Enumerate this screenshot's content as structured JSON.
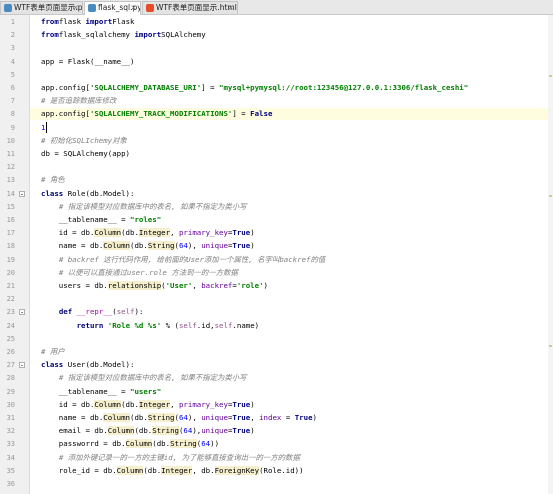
{
  "tabs": [
    {
      "label": "WTF表单页面显示.py",
      "icon": "python-file-icon",
      "color": "#4b8bbe",
      "active": false
    },
    {
      "label": "flask_sql.py",
      "icon": "python-file-icon",
      "color": "#4b8bbe",
      "active": true
    },
    {
      "label": "WTF表单页面显示.html",
      "icon": "html-file-icon",
      "color": "#e44d26",
      "active": false
    }
  ],
  "close_glyph": "×",
  "lines": [
    {
      "n": "1",
      "segs": [
        [
          "kw",
          "from"
        ],
        [
          "",
          "flask "
        ],
        [
          "kw",
          "import"
        ],
        [
          "",
          "Flask"
        ]
      ]
    },
    {
      "n": "2",
      "segs": [
        [
          "kw",
          "from"
        ],
        [
          "",
          "flask_sqlalchemy "
        ],
        [
          "kw",
          "import"
        ],
        [
          "",
          "SQLAlchemy"
        ]
      ]
    },
    {
      "n": "3",
      "segs": []
    },
    {
      "n": "4",
      "segs": [
        [
          "",
          "app = Flask(__name__)"
        ]
      ]
    },
    {
      "n": "5",
      "segs": []
    },
    {
      "n": "6",
      "segs": [
        [
          "",
          "app.config["
        ],
        [
          "str",
          "'SQLALCHEMY_DATABASE_URI'"
        ],
        [
          "",
          "] = "
        ],
        [
          "str",
          "\"mysql+pymysql://root:123456@127.0.0.1:3306/flask_ceshi\""
        ]
      ]
    },
    {
      "n": "7",
      "segs": [
        [
          "cm",
          "# 是否追踪数据库修改"
        ]
      ]
    },
    {
      "n": "8",
      "segs": [
        [
          "",
          "app.config["
        ],
        [
          "str",
          "'SQLALCHEMY_TRACK_MODIFICATIONS'"
        ],
        [
          "",
          "] = "
        ],
        [
          "kw",
          "False"
        ]
      ],
      "current": true
    },
    {
      "n": "9",
      "segs": [
        [
          "num",
          "1"
        ]
      ]
    },
    {
      "n": "10",
      "segs": [
        [
          "cm",
          "# 初始化SQLIchemy对象"
        ]
      ]
    },
    {
      "n": "11",
      "segs": [
        [
          "",
          "db = SQLAlchemy(app)"
        ]
      ]
    },
    {
      "n": "12",
      "segs": []
    },
    {
      "n": "13",
      "segs": [
        [
          "cm",
          "# 角色"
        ]
      ]
    },
    {
      "n": "14",
      "segs": [
        [
          "kw",
          "class "
        ],
        [
          "",
          "Role(db.Model):"
        ]
      ],
      "fold": true
    },
    {
      "n": "15",
      "segs": [
        [
          "",
          "    "
        ],
        [
          "cm",
          "# 指定该模型对应数据库中的表名, 如果不指定为类小写"
        ]
      ]
    },
    {
      "n": "16",
      "segs": [
        [
          "",
          "    __tablename__ = "
        ],
        [
          "str",
          "\"roles\""
        ]
      ]
    },
    {
      "n": "17",
      "segs": [
        [
          "",
          "    id = db."
        ],
        [
          "u",
          "Column"
        ],
        [
          "",
          "(db."
        ],
        [
          "u",
          "Integer"
        ],
        [
          "",
          ", "
        ],
        [
          "arg",
          "primary_key"
        ],
        [
          "",
          "="
        ],
        [
          "kw",
          "True"
        ],
        [
          "",
          ")"
        ]
      ]
    },
    {
      "n": "18",
      "segs": [
        [
          "",
          "    name = db."
        ],
        [
          "u",
          "Column"
        ],
        [
          "",
          "(db."
        ],
        [
          "u",
          "String"
        ],
        [
          "",
          "("
        ],
        [
          "num",
          "64"
        ],
        [
          "",
          "), "
        ],
        [
          "arg",
          "unique"
        ],
        [
          "",
          "="
        ],
        [
          "kw",
          "True"
        ],
        [
          "",
          ")"
        ]
      ]
    },
    {
      "n": "19",
      "segs": [
        [
          "",
          "    "
        ],
        [
          "cm",
          "# backref 这行代码作用, 给前面的User添加一个属性, 名字叫backref的值"
        ]
      ]
    },
    {
      "n": "20",
      "segs": [
        [
          "",
          "    "
        ],
        [
          "cm",
          "# 以便可以直接通过user.role 方法到一的一方数据"
        ]
      ]
    },
    {
      "n": "21",
      "segs": [
        [
          "",
          "    users = db."
        ],
        [
          "u",
          "relationship"
        ],
        [
          "",
          "("
        ],
        [
          "str",
          "'User'"
        ],
        [
          "",
          ", "
        ],
        [
          "arg",
          "backref"
        ],
        [
          "",
          "="
        ],
        [
          "str",
          "'role'"
        ],
        [
          "",
          ")"
        ]
      ]
    },
    {
      "n": "22",
      "segs": []
    },
    {
      "n": "23",
      "segs": [
        [
          "",
          "    "
        ],
        [
          "kw",
          "def "
        ],
        [
          "fn",
          "__repr__"
        ],
        [
          "",
          "("
        ],
        [
          "self",
          "self"
        ],
        [
          "",
          "):"
        ]
      ],
      "fold": true
    },
    {
      "n": "24",
      "segs": [
        [
          "",
          "        "
        ],
        [
          "kw",
          "return "
        ],
        [
          "str",
          "'Role %d %s'"
        ],
        [
          "",
          " % ("
        ],
        [
          "self",
          "self"
        ],
        [
          "",
          ".id,"
        ],
        [
          "self",
          "self"
        ],
        [
          "",
          ".name)"
        ]
      ]
    },
    {
      "n": "25",
      "segs": []
    },
    {
      "n": "26",
      "segs": [
        [
          "cm",
          "# 用户"
        ]
      ]
    },
    {
      "n": "27",
      "segs": [
        [
          "kw",
          "class "
        ],
        [
          "",
          "User(db.Model):"
        ]
      ],
      "fold": true
    },
    {
      "n": "28",
      "segs": [
        [
          "",
          "    "
        ],
        [
          "cm",
          "# 指定该模型对应数据库中的表名, 如果不指定为类小写"
        ]
      ]
    },
    {
      "n": "29",
      "segs": [
        [
          "",
          "    __tablename__ = "
        ],
        [
          "str",
          "\"users\""
        ]
      ]
    },
    {
      "n": "30",
      "segs": [
        [
          "",
          "    id = db."
        ],
        [
          "u",
          "Column"
        ],
        [
          "",
          "(db."
        ],
        [
          "u",
          "Integer"
        ],
        [
          "",
          ", "
        ],
        [
          "arg",
          "primary_key"
        ],
        [
          "",
          "="
        ],
        [
          "kw",
          "True"
        ],
        [
          "",
          ")"
        ]
      ]
    },
    {
      "n": "31",
      "segs": [
        [
          "",
          "    name = db."
        ],
        [
          "u",
          "Column"
        ],
        [
          "",
          "(db."
        ],
        [
          "u",
          "String"
        ],
        [
          "",
          "("
        ],
        [
          "num",
          "64"
        ],
        [
          "",
          "), "
        ],
        [
          "arg",
          "unique"
        ],
        [
          "",
          "="
        ],
        [
          "kw",
          "True"
        ],
        [
          "",
          ", "
        ],
        [
          "arg",
          "index"
        ],
        [
          "",
          " = "
        ],
        [
          "kw",
          "True"
        ],
        [
          "",
          ")"
        ]
      ]
    },
    {
      "n": "32",
      "segs": [
        [
          "",
          "    email = db."
        ],
        [
          "u",
          "Column"
        ],
        [
          "",
          "(db."
        ],
        [
          "u",
          "String"
        ],
        [
          "",
          "("
        ],
        [
          "num",
          "64"
        ],
        [
          "",
          "),"
        ],
        [
          "arg",
          "unique"
        ],
        [
          "",
          "="
        ],
        [
          "kw",
          "True"
        ],
        [
          "",
          ")"
        ]
      ]
    },
    {
      "n": "33",
      "segs": [
        [
          "",
          "    passworrd = db."
        ],
        [
          "u",
          "Column"
        ],
        [
          "",
          "(db."
        ],
        [
          "u",
          "String"
        ],
        [
          "",
          "("
        ],
        [
          "num",
          "64"
        ],
        [
          "",
          "))"
        ]
      ]
    },
    {
      "n": "34",
      "segs": [
        [
          "",
          "    "
        ],
        [
          "cm",
          "# 添加外键记录一的一方的主键id, 为了能够直接查询出一的一方的数据"
        ]
      ]
    },
    {
      "n": "35",
      "segs": [
        [
          "",
          "    role_id = db."
        ],
        [
          "u",
          "Column"
        ],
        [
          "",
          "(db."
        ],
        [
          "u",
          "Integer"
        ],
        [
          "",
          ", db."
        ],
        [
          "u",
          "ForeignKey"
        ],
        [
          "",
          "(Role.id))"
        ]
      ]
    },
    {
      "n": "36",
      "segs": []
    }
  ]
}
